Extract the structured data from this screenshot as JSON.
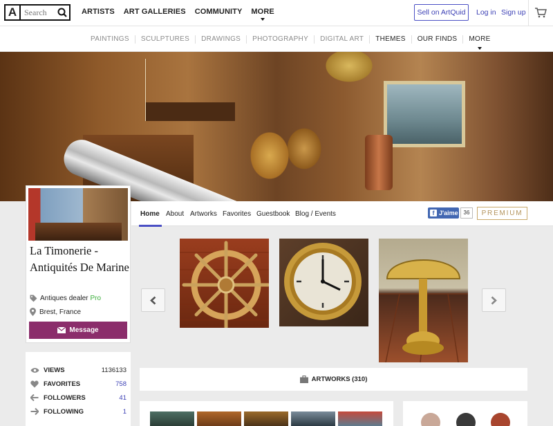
{
  "header": {
    "logo_letter": "A",
    "search_placeholder": "Search",
    "nav": [
      "ARTISTS",
      "ART GALLERIES",
      "COMMUNITY",
      "MORE"
    ],
    "sell_label": "Sell on ArtQuid",
    "login_label": "Log in",
    "signup_label": "Sign up"
  },
  "categories": [
    "PAINTINGS",
    "SCULPTURES",
    "DRAWINGS",
    "PHOTOGRAPHY",
    "DIGITAL ART",
    "THEMES",
    "OUR FINDS",
    "MORE"
  ],
  "profile": {
    "name": "La Timonerie - Antiquités De Marine",
    "role": "Antiques dealer",
    "badge": "Pro",
    "location": "Brest, France",
    "message_label": "Message"
  },
  "tabs": [
    "Home",
    "About",
    "Artworks",
    "Favorites",
    "Guestbook",
    "Blog / Events"
  ],
  "social": {
    "fb_label": "J'aime",
    "fb_count": "36",
    "premium_label": "PREMIUM"
  },
  "stats": [
    {
      "label": "VIEWS",
      "value": "1136133",
      "icon": "eye-icon"
    },
    {
      "label": "FAVORITES",
      "value": "758",
      "icon": "heart-icon"
    },
    {
      "label": "FOLLOWERS",
      "value": "41",
      "icon": "arrow-left-icon"
    },
    {
      "label": "FOLLOWING",
      "value": "1",
      "icon": "arrow-right-icon"
    }
  ],
  "artworks_label": "ARTWORKS (310)",
  "colors": {
    "accent": "#3c40b5",
    "message_button": "#8b2d6b",
    "pro_badge": "#3cae3c",
    "premium": "#b3935b",
    "facebook": "#4267b2"
  }
}
